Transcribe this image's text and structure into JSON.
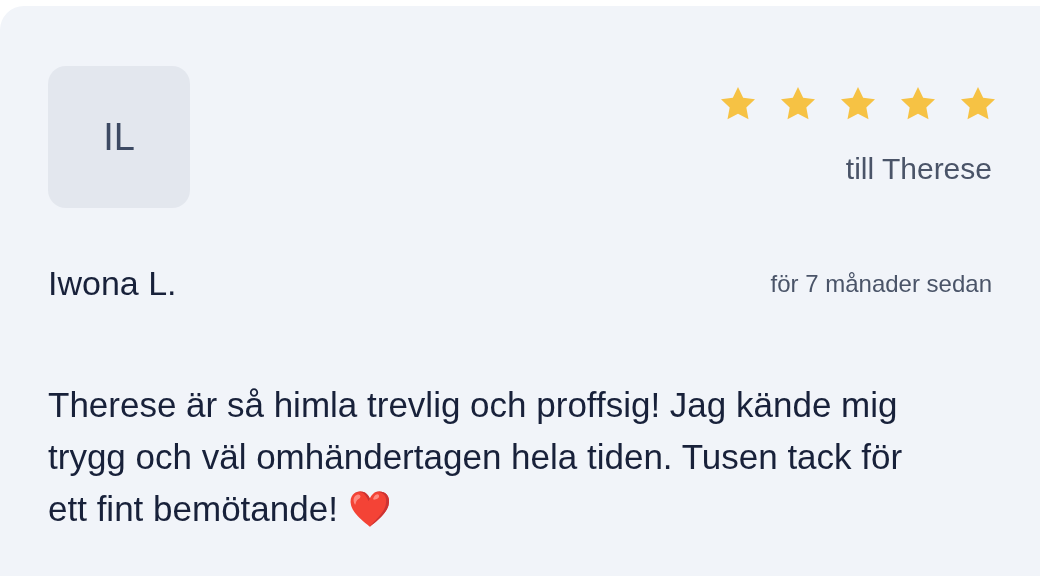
{
  "review": {
    "avatar_initials": "IL",
    "stars": 5,
    "recipient": "till Therese",
    "author": "Iwona L.",
    "time": "för 7 månader sedan",
    "text": "Therese är så himla trevlig och proffsig! Jag kände mig trygg och väl omhändertagen hela tiden. Tusen tack för ett fint bemötande! ❤️"
  }
}
